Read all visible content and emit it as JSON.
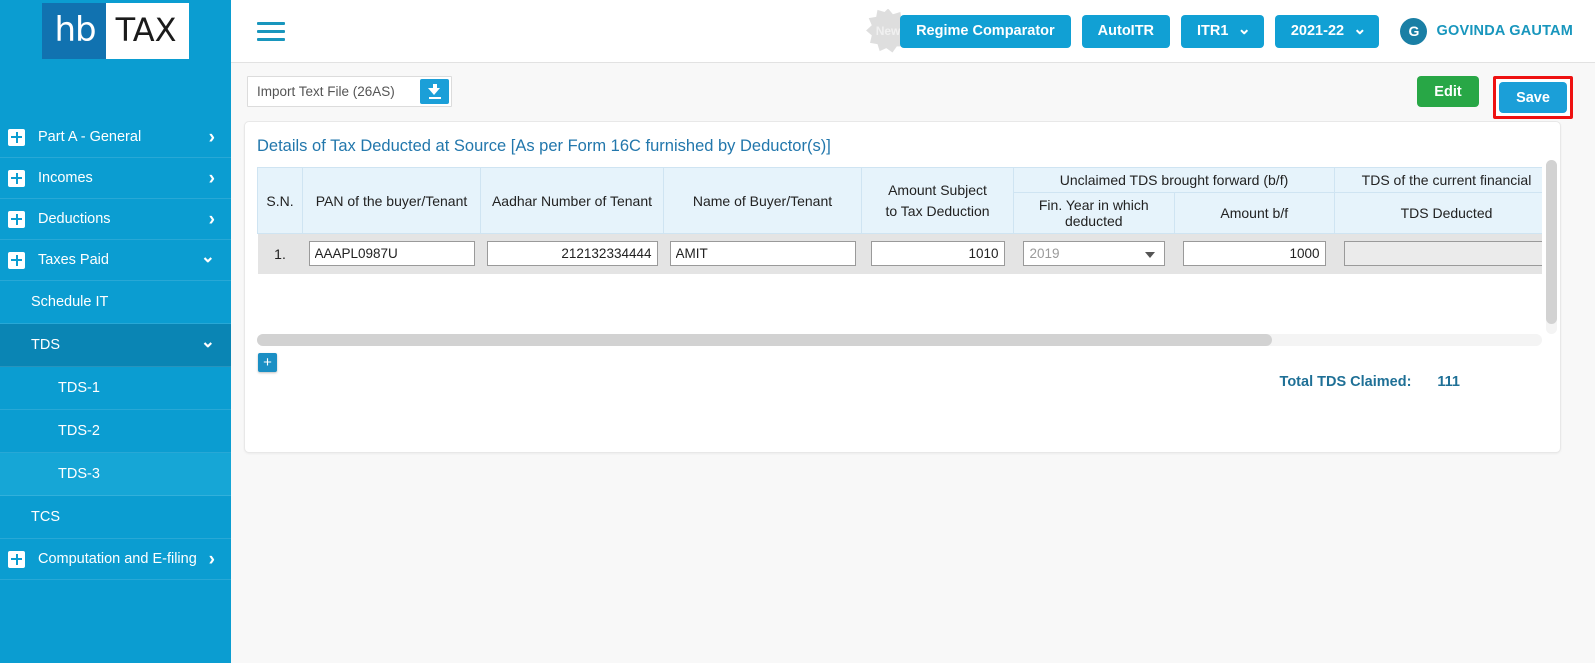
{
  "brand": {
    "logo_hb": "hb",
    "logo_tax": "TAX",
    "accent_blue": "#0b9dd1",
    "accent_dark_blue": "#1172b0",
    "save_highlight_color": "#ee1111",
    "edit_green": "#28a746"
  },
  "sidebar": {
    "items": [
      {
        "label": "Part A - General",
        "level": 1,
        "icon": "plus-box-icon",
        "chevron": "right",
        "state": "normal"
      },
      {
        "label": "Incomes",
        "level": 1,
        "icon": "plus-box-icon",
        "chevron": "right",
        "state": "normal"
      },
      {
        "label": "Deductions",
        "level": 1,
        "icon": "plus-box-icon",
        "chevron": "right",
        "state": "normal"
      },
      {
        "label": "Taxes Paid",
        "level": 1,
        "icon": "plus-box-icon",
        "chevron": "down",
        "state": "normal"
      },
      {
        "label": "Schedule IT",
        "level": 2,
        "icon": "",
        "chevron": "",
        "state": "normal"
      },
      {
        "label": "TDS",
        "level": 2,
        "icon": "",
        "chevron": "down",
        "state": "active-dark"
      },
      {
        "label": "TDS-1",
        "level": 3,
        "icon": "",
        "chevron": "",
        "state": "normal"
      },
      {
        "label": "TDS-2",
        "level": 3,
        "icon": "",
        "chevron": "",
        "state": "normal"
      },
      {
        "label": "TDS-3",
        "level": 3,
        "icon": "",
        "chevron": "",
        "state": "active-light"
      },
      {
        "label": "TCS",
        "level": 2,
        "icon": "",
        "chevron": "",
        "state": "normal"
      },
      {
        "label": "Computation and E-filing",
        "level": 1,
        "icon": "plus-box-icon",
        "chevron": "right",
        "state": "normal"
      }
    ]
  },
  "header": {
    "menu_icon": "hamburger-icon",
    "new_badge": "New",
    "regime_comparator": "Regime Comparator",
    "auto_itr": "AutoITR",
    "itr_select": "ITR1",
    "year_select": "2021-22",
    "avatar_initial": "G",
    "user_name": "GOVINDA GAUTAM"
  },
  "toolbar": {
    "import_label": "Import Text File (26AS)",
    "import_icon": "download-icon",
    "edit_label": "Edit",
    "save_label": "Save"
  },
  "card": {
    "title": "Details of Tax Deducted at Source [As per Form 16C furnished by Deductor(s)]",
    "group_headers": {
      "unclaimed": "Unclaimed TDS brought forward (b/f)",
      "current_fy": "TDS of the current financial"
    },
    "columns": [
      "S.N.",
      "PAN of the buyer/Tenant",
      "Aadhar Number of Tenant",
      "Name of Buyer/Tenant",
      "Amount Subject to Tax Deduction",
      "Fin. Year in which deducted",
      "Amount b/f",
      "TDS Deducted"
    ],
    "col_amount_line1": "Amount Subject",
    "col_amount_line2": "to Tax Deduction",
    "rows": [
      {
        "sn": "1.",
        "pan": "AAAPL0987U",
        "aadhar": "212132334444",
        "name": "AMIT",
        "amount_subject": "1010",
        "fin_year": "2019",
        "amount_bf": "1000",
        "tds_deducted": ""
      }
    ],
    "add_row_icon": "plus-icon",
    "total_label": "Total TDS Claimed:",
    "total_value": "111"
  }
}
